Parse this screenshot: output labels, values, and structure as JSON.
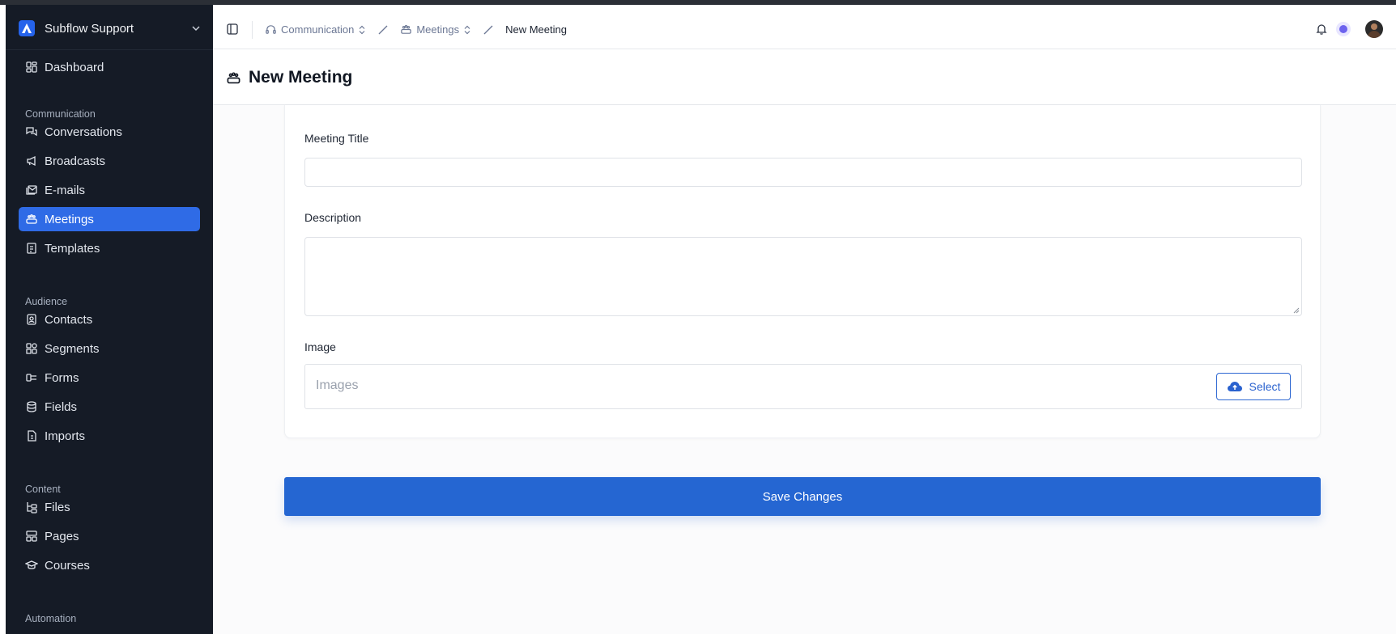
{
  "sidebar": {
    "org_name": "Subflow Support",
    "items": {
      "dashboard": "Dashboard",
      "conversations": "Conversations",
      "broadcasts": "Broadcasts",
      "emails": "E-mails",
      "meetings": "Meetings",
      "templates": "Templates",
      "contacts": "Contacts",
      "segments": "Segments",
      "forms": "Forms",
      "fields": "Fields",
      "imports": "Imports",
      "files": "Files",
      "pages": "Pages",
      "courses": "Courses"
    },
    "sections": {
      "communication": "Communication",
      "audience": "Audience",
      "content": "Content",
      "automation": "Automation"
    },
    "active_item": "meetings",
    "accent_color": "#2f6be6",
    "background_color": "#151b26"
  },
  "breadcrumb": {
    "level1": "Communication",
    "level2": "Meetings",
    "current": "New Meeting"
  },
  "page": {
    "title": "New Meeting"
  },
  "form": {
    "title_label": "Meeting Title",
    "title_value": "",
    "description_label": "Description",
    "description_value": "",
    "image_label": "Image",
    "image_placeholder": "Images",
    "select_label": "Select",
    "save_label": "Save Changes"
  },
  "colors": {
    "primary": "#2566d2",
    "notification_dot": "#6d63ee"
  },
  "icons": {
    "org": "subflow-logo-icon",
    "toggle": "sidebar-toggle-icon",
    "bell": "bell-icon",
    "upload": "cloud-upload-icon"
  }
}
